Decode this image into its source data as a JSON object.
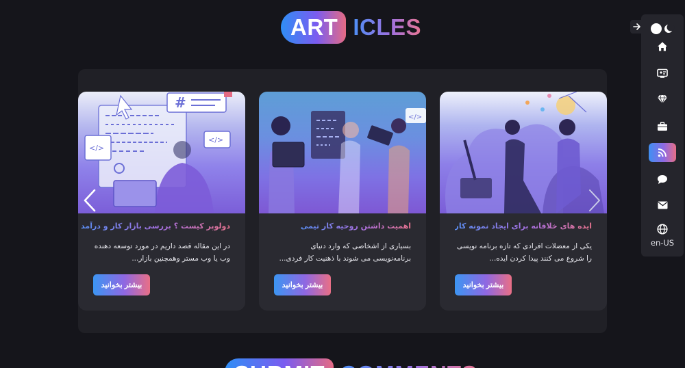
{
  "section": {
    "title_part1": "ART",
    "title_part2": "ICLES"
  },
  "articles": [
    {
      "title": "دولوپر کیست ؟ بررسی بازار کار و درآمد",
      "description": "در این مقاله قصد داریم در مورد توسعه دهنده وب یا وب مستر وهمچنین بازار...",
      "button_label": "بیشتر بخوانید",
      "image_icon": "developer-illustration-icon"
    },
    {
      "title": "اهمیت داشتن روحیه کار تیمی",
      "description": "بسیاری از اشخاصی که وارد دنیای برنامه‌نویسی می شوند با ذهنیت کار فردی...",
      "button_label": "بیشتر بخوانید",
      "image_icon": "teamwork-illustration-icon"
    },
    {
      "title": "ایده های خلاقانه برای ایجاد نمونه کار",
      "description": "یکی از معضلات افرادی که تازه برنامه نویسی را شروع می کنند پیدا کردن ایده...",
      "button_label": "بیشتر بخوانید",
      "image_icon": "creative-ideas-illustration-icon"
    }
  ],
  "carousel": {
    "prev_icon": "chevron-left-icon",
    "next_icon": "chevron-right-icon"
  },
  "nav": {
    "collapse_icon": "arrow-right-icon",
    "theme_icon": "moon-icon",
    "items": [
      {
        "name": "home",
        "icon": "home-icon"
      },
      {
        "name": "about",
        "icon": "profile-card-icon"
      },
      {
        "name": "skills",
        "icon": "diamond-icon"
      },
      {
        "name": "portfolio",
        "icon": "briefcase-icon"
      },
      {
        "name": "articles",
        "icon": "rss-icon",
        "active": true
      },
      {
        "name": "comments",
        "icon": "chat-icon"
      },
      {
        "name": "contact",
        "icon": "envelope-icon"
      },
      {
        "name": "language",
        "icon": "globe-icon"
      }
    ],
    "language_label": "en-US"
  },
  "next_section": {
    "title_part1": "SUBMIT",
    "title_part2": "COMMENTS"
  },
  "colors": {
    "background": "#15151b",
    "panel": "#202026",
    "card": "#2a2a31",
    "gradient_start": "#3c95f2",
    "gradient_mid": "#8f68e2",
    "gradient_end": "#e96f86"
  }
}
